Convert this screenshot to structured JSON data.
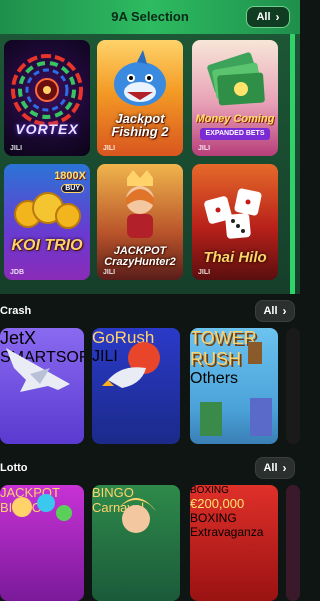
{
  "selection": {
    "title": "9A Selection",
    "all_label": "All",
    "games": [
      {
        "title": "VORTEX",
        "provider": "JILI"
      },
      {
        "title": "Jackpot Fishing 2",
        "provider": "JILI"
      },
      {
        "title": "Money Coming",
        "subtitle": "EXPANDED BETS",
        "provider": "JILI"
      },
      {
        "title": "KOI TRIO",
        "badge": "1800X",
        "buy": "BUY",
        "provider": "JDB"
      },
      {
        "title": "JACKPOT CrazyHunter2",
        "provider": "JILI"
      },
      {
        "title": "Thai Hilo",
        "provider": "JILI"
      }
    ]
  },
  "crash": {
    "title": "Crash",
    "all_label": "All",
    "games": [
      {
        "title": "JetX",
        "provider": "SMARTSOFT"
      },
      {
        "title": "GoRush",
        "provider": "JILI"
      },
      {
        "title": "TOWER RUSH",
        "provider": "Others"
      }
    ]
  },
  "lotto": {
    "title": "Lotto",
    "all_label": "All",
    "games": [
      {
        "title": "JACKPOT BINGO"
      },
      {
        "title": "BINGO Carnaval"
      },
      {
        "title": "BOXING Extravaganza",
        "top": "BOXING",
        "prize": "€200,000"
      }
    ]
  }
}
